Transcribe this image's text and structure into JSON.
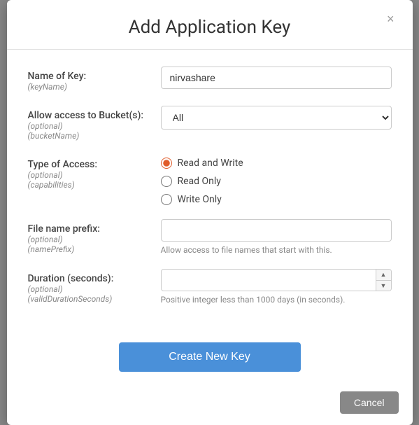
{
  "modal": {
    "title": "Add Application Key",
    "close_label": "×",
    "fields": {
      "key_name": {
        "label": "Name of Key:",
        "sublabel": "(keyName)",
        "value": "nirvashare",
        "placeholder": ""
      },
      "bucket": {
        "label": "Allow access to Bucket(s):",
        "sublabel": "(optional)",
        "sublabel2": "(bucketName)",
        "options": [
          "All"
        ],
        "selected": "All"
      },
      "access_type": {
        "label": "Type of Access:",
        "sublabel": "(optional)",
        "sublabel2": "(capabilities)",
        "options": [
          {
            "label": "Read and Write",
            "value": "readWrite",
            "checked": true
          },
          {
            "label": "Read Only",
            "value": "readOnly",
            "checked": false
          },
          {
            "label": "Write Only",
            "value": "writeOnly",
            "checked": false
          }
        ]
      },
      "file_prefix": {
        "label": "File name prefix:",
        "sublabel": "(optional)",
        "sublabel2": "(namePrefix)",
        "value": "",
        "placeholder": "",
        "hint": "Allow access to file names that start with this."
      },
      "duration": {
        "label": "Duration (seconds):",
        "sublabel": "(optional)",
        "sublabel2": "(validDurationSeconds)",
        "value": "",
        "placeholder": "",
        "hint": "Positive integer less than 1000 days (in seconds)."
      }
    },
    "create_button": "Create New Key",
    "cancel_button": "Cancel"
  }
}
